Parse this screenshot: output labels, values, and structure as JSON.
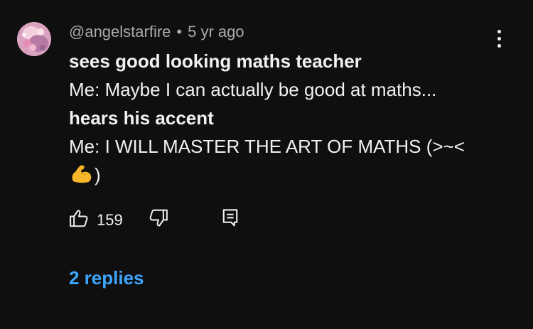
{
  "comment": {
    "author": "@angelstarfire",
    "separator": "•",
    "time": "5 yr ago",
    "lines": [
      "sees good looking maths teacher",
      "Me: Maybe I can actually be good at maths...",
      "hears his accent",
      "Me: I WILL MASTER THE ART OF MATHS (>~<",
      ")"
    ],
    "emoji": "flexed-biceps",
    "like_count": "159",
    "replies_label": "2 replies"
  },
  "icons": {
    "like": "thumbs-up-icon",
    "dislike": "thumbs-down-icon",
    "reply": "comment-reply-icon",
    "more": "more-vertical-icon"
  },
  "colors": {
    "background": "#0f0f0f",
    "text": "#f1f1f1",
    "meta": "#aaaaaa",
    "link": "#3ea6ff"
  }
}
